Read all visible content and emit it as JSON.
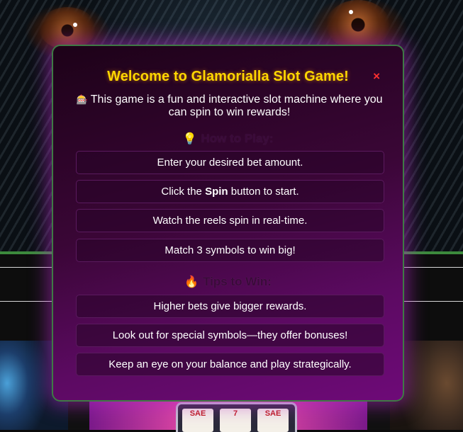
{
  "modal": {
    "title": "Welcome to Glamorialla Slot Game!",
    "close_symbol": "×",
    "intro_icon": "🎰",
    "intro_text": "This game is a fun and interactive slot machine where you can spin to win rewards!",
    "how_to_play": {
      "icon": "💡",
      "title": "How to Play:",
      "steps": [
        {
          "text": "Enter your desired bet amount."
        },
        {
          "before": "Click the ",
          "strong": "Spin",
          "after": " button to start."
        },
        {
          "text": "Watch the reels spin in real-time."
        },
        {
          "text": "Match 3 symbols to win big!"
        }
      ]
    },
    "tips": {
      "icon": "🔥",
      "title": "Tips to Win:",
      "items": [
        "Higher bets give bigger rewards.",
        "Look out for special symbols—they offer bonuses!",
        "Keep an eye on your balance and play strategically."
      ]
    }
  },
  "background": {
    "reel_labels": [
      "SAE",
      "7",
      "SAE"
    ],
    "colors": {
      "modal_border": "#3f7a45",
      "title_gold": "#ffd700",
      "close_red": "#ff3030",
      "green_line": "#3c8a3c"
    }
  }
}
